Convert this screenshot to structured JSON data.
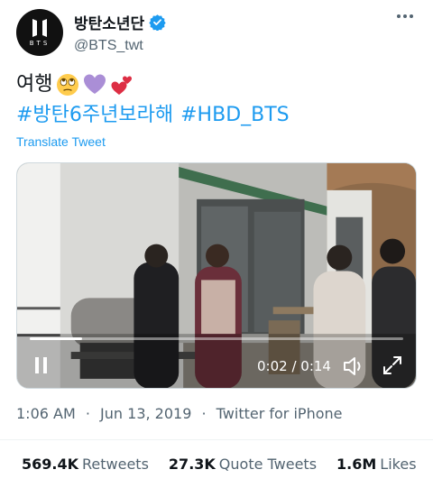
{
  "user": {
    "display_name": "방탄소년단",
    "handle": "@BTS_twt",
    "avatar_text": "BTS",
    "verified": true
  },
  "tweet": {
    "text": "여행",
    "emojis": [
      "face-with-rolling-eyes-emoji",
      "purple-heart-emoji",
      "two-hearts-emoji"
    ],
    "hashtags": [
      "#방탄6주년보라해",
      "#HBD_BTS"
    ],
    "translate_label": "Translate Tweet"
  },
  "video": {
    "elapsed": "0:02",
    "duration": "0:14",
    "time_display": "0:02 / 0:14",
    "progress": 0.14,
    "state": "paused"
  },
  "meta": {
    "time": "1:06 AM",
    "separator": "·",
    "date": "Jun 13, 2019",
    "source": "Twitter for iPhone"
  },
  "stats": {
    "retweets_count": "569.4K",
    "retweets_label": "Retweets",
    "quotes_count": "27.3K",
    "quotes_label": "Quote Tweets",
    "likes_count": "1.6M",
    "likes_label": "Likes"
  },
  "colors": {
    "accent": "#1d9bf0",
    "secondary_text": "#536471",
    "primary_text": "#0f1419"
  }
}
